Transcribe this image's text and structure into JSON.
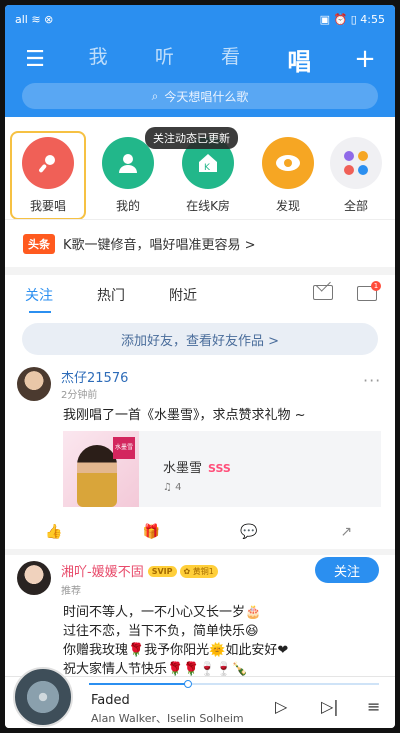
{
  "status": {
    "left": "all ≋ ⊗",
    "right": "▣ ⏰ ▯ 4:55"
  },
  "nav": {
    "menu_icon": "hamburger-icon",
    "tabs": [
      {
        "label": "我",
        "active": false
      },
      {
        "label": "听",
        "active": false
      },
      {
        "label": "看",
        "active": false
      },
      {
        "label": "唱",
        "active": true
      }
    ],
    "add_icon": "plus-icon"
  },
  "search": {
    "placeholder": "今天想唱什么歌"
  },
  "tooltip": "关注动态已更新",
  "quick": [
    {
      "label": "我要唱",
      "icon": "microphone-icon",
      "color": "#f06057"
    },
    {
      "label": "我的",
      "icon": "person-icon",
      "color": "#22b78a"
    },
    {
      "label": "在线K房",
      "icon": "home-k-icon",
      "color": "#22b78a"
    },
    {
      "label": "发现",
      "icon": "eye-icon",
      "color": "#f6a623"
    },
    {
      "label": "全部",
      "icon": "grid-icon",
      "color": "#f0f0f3"
    }
  ],
  "banner": {
    "tag": "头条",
    "text": "K歌一键修音，唱好唱准更容易 >"
  },
  "feed_tabs": [
    {
      "label": "关注",
      "active": true
    },
    {
      "label": "热门",
      "active": false
    },
    {
      "label": "附近",
      "active": false
    }
  ],
  "feed_badge": "1",
  "add_friend": "添加好友，查看好友作品 >",
  "post1": {
    "user": "杰仔21576",
    "time": "2分钟前",
    "more": "···",
    "text": "我刚唱了一首《水墨雪》，求点赞求礼物 ~",
    "song": {
      "name": "水墨雪",
      "grade": "SSS",
      "listens": "♫ 4",
      "cover_label": "水墨雪"
    }
  },
  "post2": {
    "user": "湘吖-媛媛不固",
    "svip": "SVIP",
    "level": "✿ 黄铜1",
    "time": "推荐",
    "follow": "关注",
    "lines": [
      "时间不等人，一不小心又长一岁🎂",
      "过往不恋，当下不负，简单快乐😆",
      "你赠我玫瑰🌹我予你阳光🌞如此安好❤",
      "祝大家情人节快乐🌹🌹🍷🍷🍾"
    ]
  },
  "player": {
    "title": "Faded",
    "artist": "Alan Walker、Iselin Solheim",
    "progress": 0.34
  }
}
